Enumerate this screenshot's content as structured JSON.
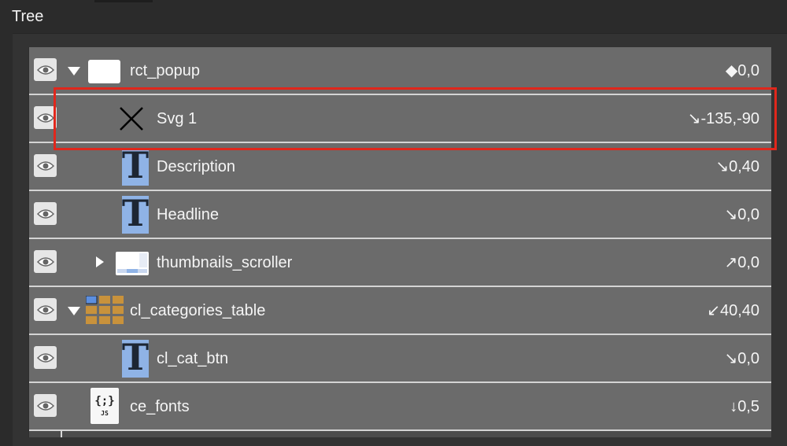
{
  "panel": {
    "title": "Tree"
  },
  "rows": [
    {
      "name": "rct_popup",
      "position": "◆0,0",
      "expander": "down",
      "icon": "rectangle-icon"
    },
    {
      "name": "Svg 1",
      "position": "↘-135,-90",
      "expander": "none",
      "icon": "svg-cross-icon"
    },
    {
      "name": "Description",
      "position": "↘0,40",
      "expander": "none",
      "icon": "text-icon"
    },
    {
      "name": "Headline",
      "position": "↘0,0",
      "expander": "none",
      "icon": "text-icon"
    },
    {
      "name": "thumbnails_scroller",
      "position": "↗0,0",
      "expander": "right",
      "icon": "scroller-icon"
    },
    {
      "name": "cl_categories_table",
      "position": "↙40,40",
      "expander": "down",
      "icon": "table-icon"
    },
    {
      "name": "cl_cat_btn",
      "position": "↘0,0",
      "expander": "none",
      "icon": "text-icon"
    },
    {
      "name": "ce_fonts",
      "position": "↓0,5",
      "expander": "none",
      "icon": "js-file-icon"
    }
  ],
  "icons": {
    "text_glyph": "T",
    "js_glyph_top": "{;}",
    "js_glyph_bottom": "JS"
  },
  "colors": {
    "highlight": "#e0271c",
    "row": "#6b6b6b",
    "text_icon": "#8fb3e6"
  }
}
